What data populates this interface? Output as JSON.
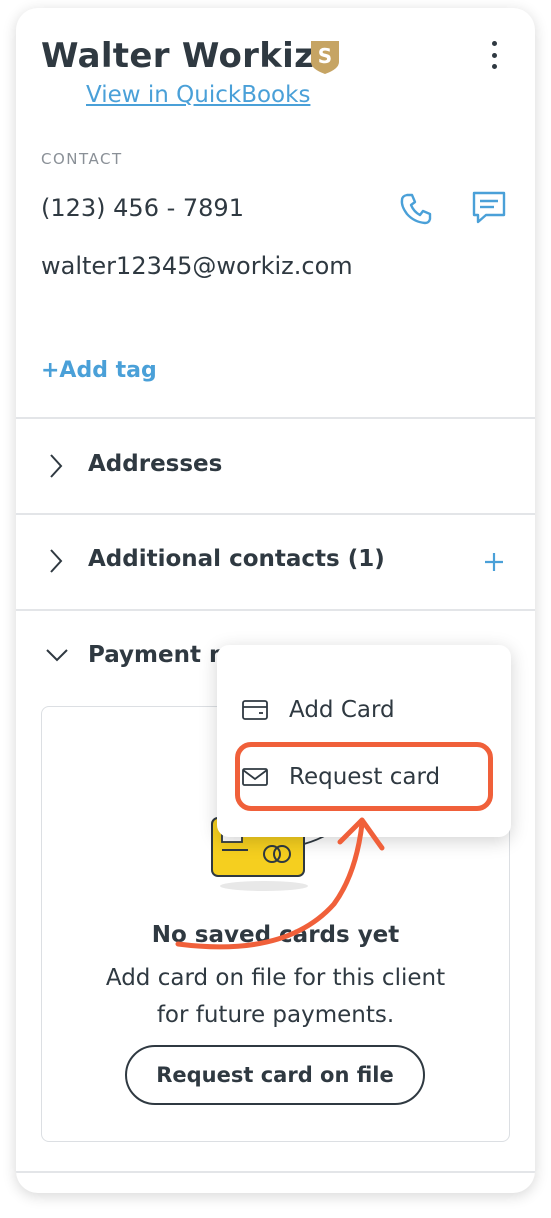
{
  "client": {
    "name": "Walter Workiz",
    "badge_letter": "S",
    "view_link": "View in QuickBooks"
  },
  "contact": {
    "section_label": "CONTACT",
    "phone": "(123) 456 - 7891",
    "email": "walter12345@workiz.com",
    "add_tag": "+Add tag"
  },
  "sections": {
    "addresses": "Addresses",
    "additional_contacts": "Additional contacts (1)",
    "payment_methods": "Payment m"
  },
  "payment": {
    "empty_title": "No saved cards yet",
    "empty_line1": "Add card on file for this client",
    "empty_line2": "for future payments.",
    "request_button": "Request card on file"
  },
  "dropdown": {
    "add_card": "Add Card",
    "request_card": "Request card"
  },
  "colors": {
    "accent_blue": "#4aa0d8",
    "badge_gold": "#c6a463",
    "highlight_orange": "#f0603a",
    "card_yellow": "#f5cf1f"
  },
  "icons": [
    "badge-icon",
    "kebab-menu-icon",
    "phone-icon",
    "message-icon",
    "chevron-right-icon",
    "chevron-down-icon",
    "plus-icon",
    "credit-card-icon",
    "envelope-icon"
  ]
}
